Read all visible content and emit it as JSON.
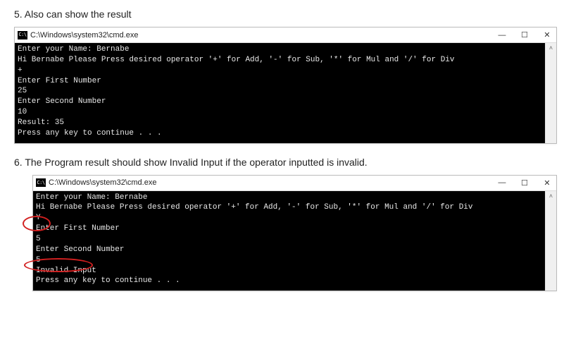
{
  "step5": {
    "heading": "5. Also can show the result",
    "window_title": "C:\\Windows\\system32\\cmd.exe",
    "icon_label": "C:\\",
    "console_lines": [
      "Enter your Name: Bernabe",
      "Hi Bernabe Please Press desired operator '+' for Add, '-' for Sub, '*' for Mul and '/' for Div",
      "+",
      "Enter First Number",
      "25",
      "Enter Second Number",
      "10",
      "Result: 35",
      "Press any key to continue . . ."
    ]
  },
  "step6": {
    "heading": "6. The Program result should show Invalid Input if the operator inputted is invalid.",
    "window_title": "C:\\Windows\\system32\\cmd.exe",
    "icon_label": "C:\\",
    "console_lines": [
      "Enter your Name: Bernabe",
      "Hi Bernabe Please Press desired operator '+' for Add, '-' for Sub, '*' for Mul and '/' for Div",
      "Y",
      "Enter First Number",
      "5",
      "Enter Second Number",
      "5",
      "Invalid Input",
      "Press any key to continue . . ."
    ]
  },
  "controls": {
    "minimize": "—",
    "maximize": "☐",
    "close": "✕",
    "scroll_up": "˄"
  }
}
